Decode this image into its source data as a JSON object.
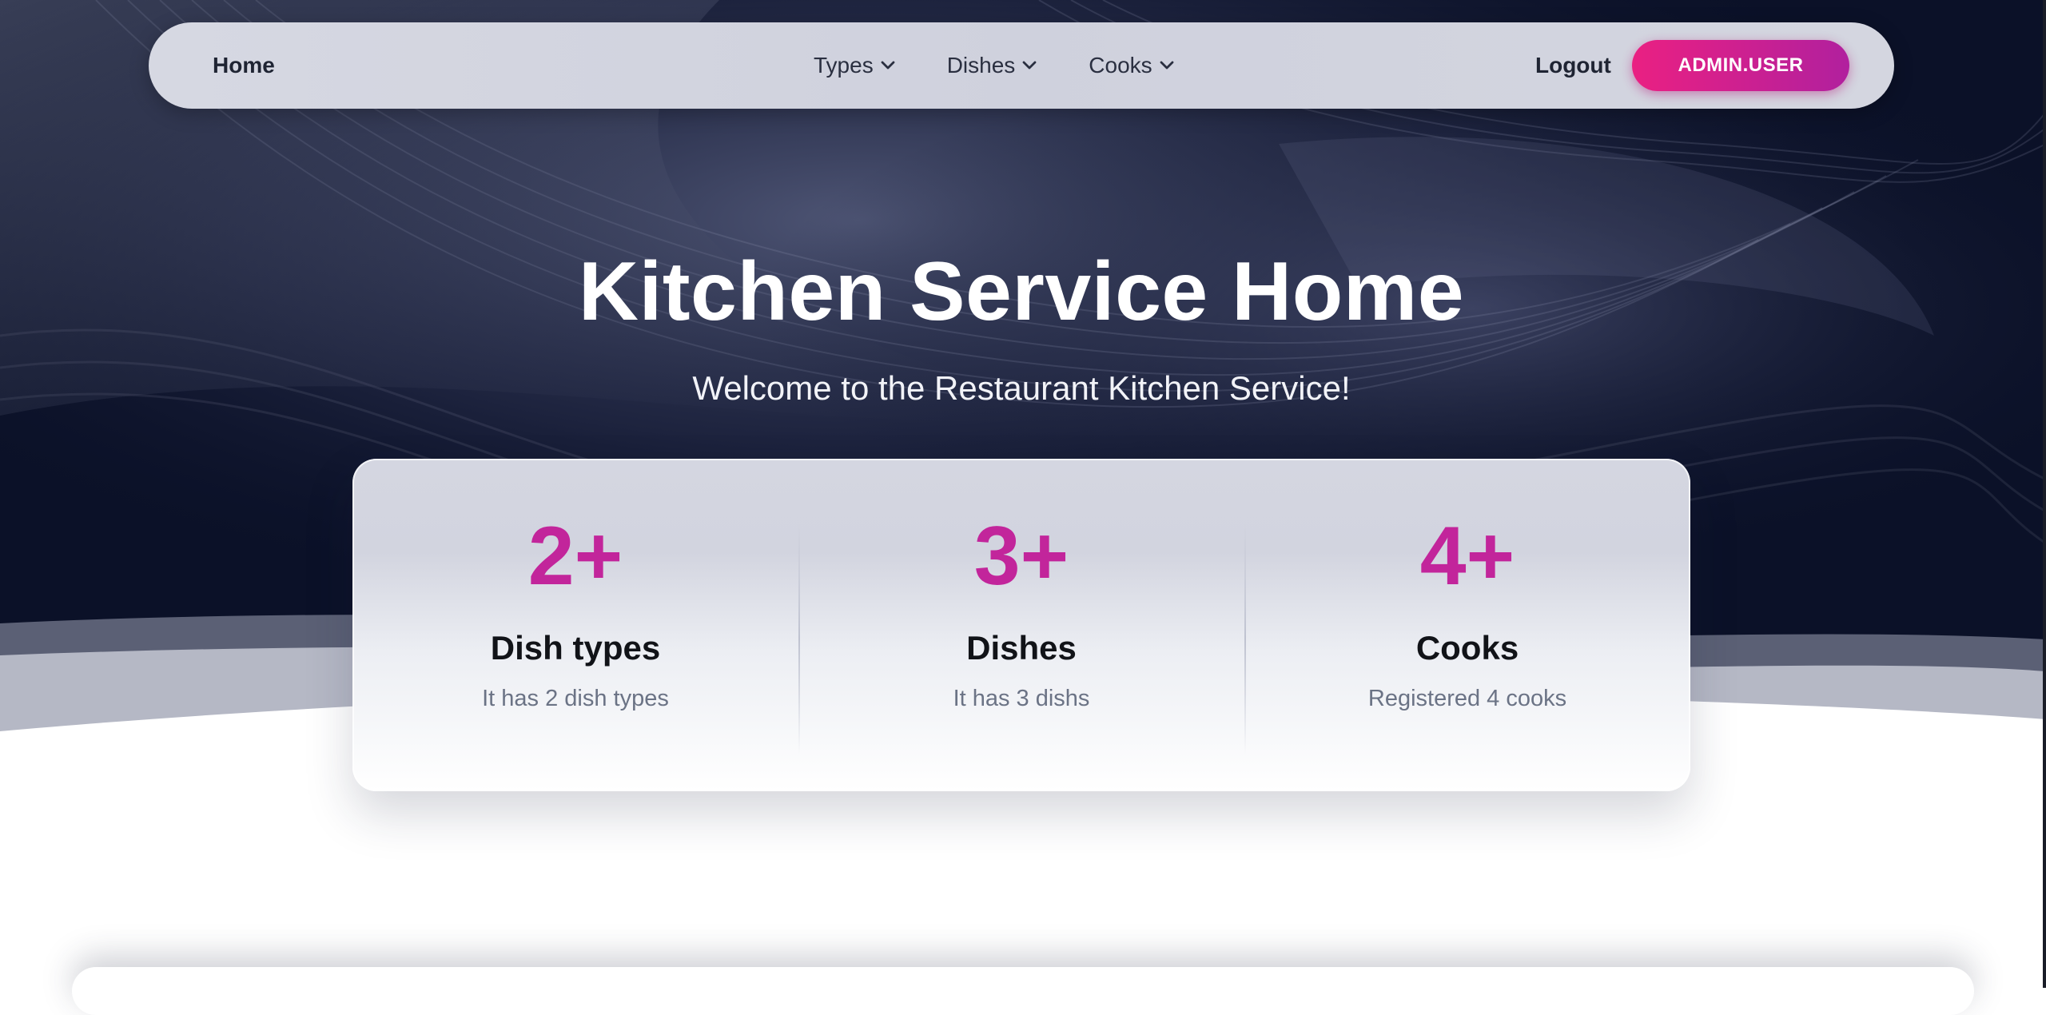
{
  "nav": {
    "home_label": "Home",
    "dropdowns": [
      {
        "label": "Types"
      },
      {
        "label": "Dishes"
      },
      {
        "label": "Cooks"
      }
    ],
    "logout_label": "Logout",
    "user_button_label": "ADMIN.USER"
  },
  "hero": {
    "title": "Kitchen Service Home",
    "subtitle": "Welcome to the Restaurant Kitchen Service!"
  },
  "stats": [
    {
      "value": "2+",
      "label": "Dish types",
      "description": "It has 2 dish types"
    },
    {
      "value": "3+",
      "label": "Dishes",
      "description": "It has 3 dishs"
    },
    {
      "value": "4+",
      "label": "Cooks",
      "description": "Registered 4 cooks"
    }
  ],
  "colors": {
    "accent": "#c2259b",
    "button_gradient_start": "#ea2082",
    "button_gradient_end": "#b1209e",
    "hero_background": "#0c1229",
    "navbar_background": "#d3d5df"
  },
  "icons": {
    "dropdown": "chevron-down-icon"
  }
}
